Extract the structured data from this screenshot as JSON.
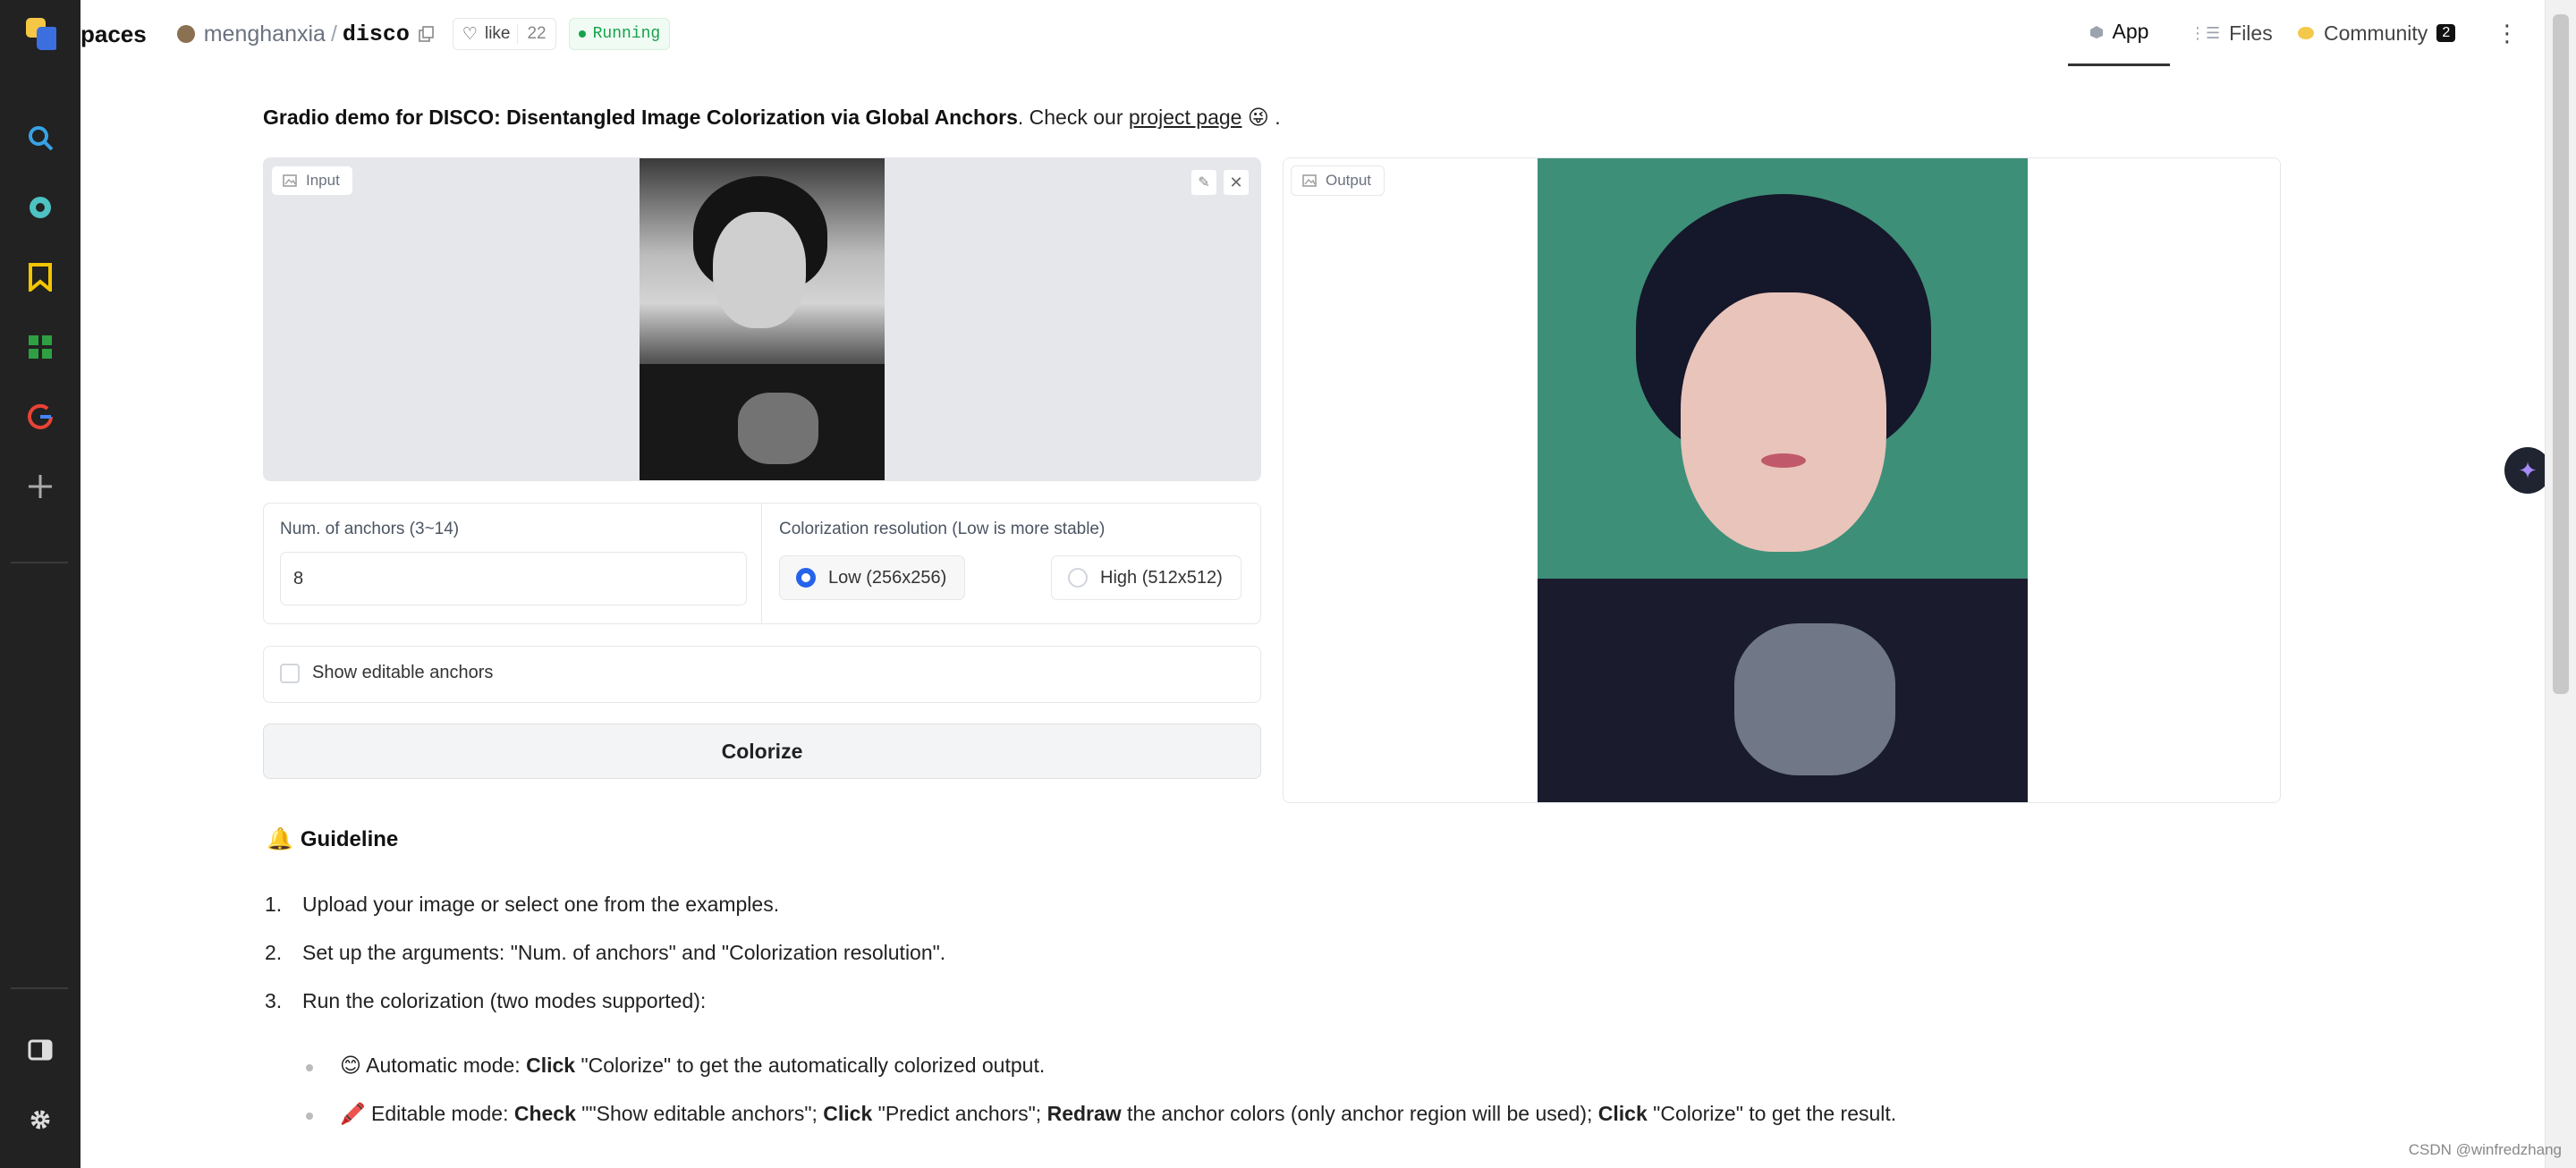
{
  "header": {
    "app_fragment": "paces",
    "owner": "menghanxia",
    "separator": "/",
    "repo": "disco",
    "like_label": "like",
    "like_count": "22",
    "status": "Running"
  },
  "tabs": [
    {
      "label": "App",
      "icon": "cube-icon"
    },
    {
      "label": "Files",
      "icon": "files-icon"
    },
    {
      "label": "Community",
      "icon": "chat-icon",
      "badge": "2"
    }
  ],
  "intro": {
    "lead": "Gradio demo for DISCO: Disentangled Image Colorization via Global Anchors",
    "text": ". Check our ",
    "link": "project page",
    "emoji": "😜",
    "tail": " ."
  },
  "input_panel": {
    "label": "Input"
  },
  "output_panel": {
    "label": "Output"
  },
  "anchors": {
    "label": "Num. of anchors (3~14)",
    "value": "8"
  },
  "resolution": {
    "label": "Colorization resolution (Low is more stable)",
    "options": [
      "Low (256x256)",
      "High (512x512)"
    ],
    "selected": "Low (256x256)"
  },
  "editable": {
    "label": "Show editable anchors",
    "checked": false
  },
  "colorize_label": "Colorize",
  "guideline": {
    "emoji": "🔔",
    "title": "Guideline",
    "steps": [
      "Upload your image or select one from the examples.",
      "Set up the arguments: \"Num. of anchors\" and \"Colorization resolution\".",
      "Run the colorization (two modes supported):"
    ],
    "modes": [
      {
        "emoji": "😊",
        "parts": [
          [
            "Automatic mode: ",
            false
          ],
          [
            "Click",
            true
          ],
          [
            " \"Colorize\" to get the automatically colorized output.",
            false
          ]
        ]
      },
      {
        "emoji": "🖍️",
        "parts": [
          [
            "Editable mode: ",
            false
          ],
          [
            "Check",
            true
          ],
          [
            " \"\"Show editable anchors\"; ",
            false
          ],
          [
            "Click",
            true
          ],
          [
            " \"Predict anchors\"; ",
            false
          ],
          [
            "Redraw",
            true
          ],
          [
            " the anchor colors (only anchor region will be used); ",
            false
          ],
          [
            "Click",
            true
          ],
          [
            " \"Colorize\" to get the result.",
            false
          ]
        ]
      }
    ]
  },
  "watermark": "CSDN @winfredzhang",
  "colors": {
    "sidebar": "#222222",
    "accent": "#2563eb",
    "running": "#16a34a"
  }
}
